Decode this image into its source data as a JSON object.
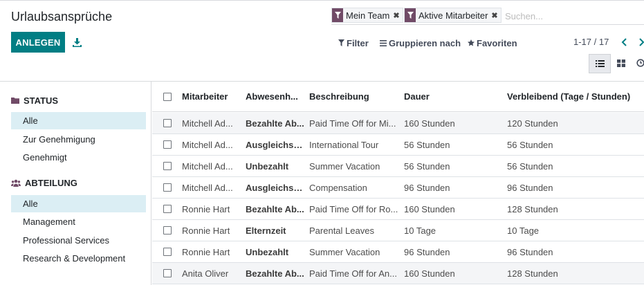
{
  "page": {
    "title": "Urlaubsansprüche"
  },
  "toolbar": {
    "create_label": "ANLEGEN",
    "download_icon": "download-icon"
  },
  "search": {
    "facets": [
      {
        "label": "Mein Team",
        "icon": "filter-icon"
      },
      {
        "label": "Aktive Mitarbeiter",
        "icon": "filter-icon"
      }
    ],
    "placeholder": "Suchen..."
  },
  "filters": {
    "filter_label": "Filter",
    "groupby_label": "Gruppieren nach",
    "favorites_label": "Favoriten"
  },
  "pager": {
    "value": "1-17 / 17"
  },
  "colors": {
    "primary": "#017e84",
    "brand": "#714b67",
    "active_bg": "#dbeef4"
  },
  "sidebar": {
    "sections": [
      {
        "title": "STATUS",
        "icon": "folder-icon",
        "items": [
          "Alle",
          "Zur Genehmigung",
          "Genehmigt"
        ],
        "active": "Alle"
      },
      {
        "title": "ABTEILUNG",
        "icon": "users-icon",
        "items": [
          "Alle",
          "Management",
          "Professional Services",
          "Research & Development"
        ],
        "active": "Alle"
      }
    ]
  },
  "table": {
    "columns": [
      "Mitarbeiter",
      "Abwesenh...",
      "Beschreibung",
      "Dauer",
      "Verbleibend (Tage / Stunden)"
    ],
    "rows": [
      {
        "employee": "Mitchell Ad...",
        "type": "Bezahlte Ab...",
        "description": "Paid Time Off for Mi...",
        "duration": "160 Stunden",
        "remaining": "120 Stunden"
      },
      {
        "employee": "Mitchell Ad...",
        "type": "Ausgleichstage",
        "description": "International Tour",
        "duration": "56 Stunden",
        "remaining": "56 Stunden"
      },
      {
        "employee": "Mitchell Ad...",
        "type": "Unbezahlt",
        "description": "Summer Vacation",
        "duration": "56 Stunden",
        "remaining": "56 Stunden"
      },
      {
        "employee": "Mitchell Ad...",
        "type": "Ausgleichstage",
        "description": "Compensation",
        "duration": "96 Stunden",
        "remaining": "96 Stunden"
      },
      {
        "employee": "Ronnie Hart",
        "type": "Bezahlte Ab...",
        "description": "Paid Time Off for Ro...",
        "duration": "160 Stunden",
        "remaining": "128 Stunden"
      },
      {
        "employee": "Ronnie Hart",
        "type": "Elternzeit",
        "description": "Parental Leaves",
        "duration": "10 Tage",
        "remaining": "10 Tage"
      },
      {
        "employee": "Ronnie Hart",
        "type": "Unbezahlt",
        "description": "Summer Vacation",
        "duration": "96 Stunden",
        "remaining": "96 Stunden"
      },
      {
        "employee": "Anita Oliver",
        "type": "Bezahlte Ab...",
        "description": "Paid Time Off for An...",
        "duration": "160 Stunden",
        "remaining": "128 Stunden"
      }
    ]
  }
}
